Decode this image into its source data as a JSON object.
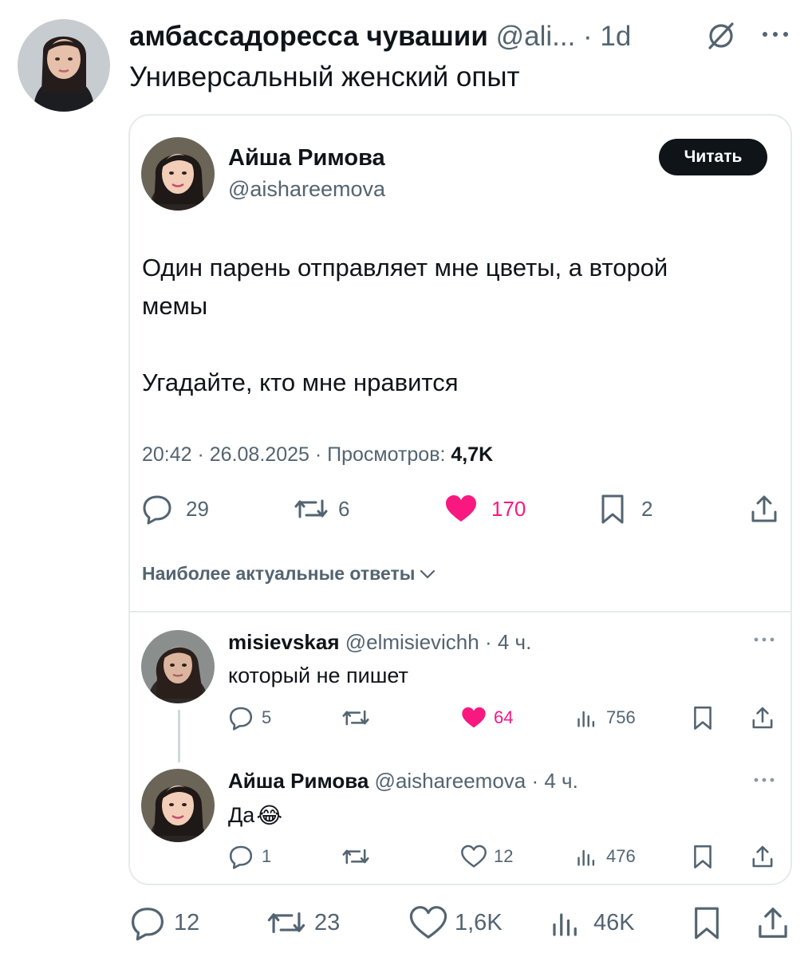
{
  "outer": {
    "display_name": "амбассадоресса чувашии",
    "handle": "@ali...",
    "separator": " · ",
    "time": "1d",
    "text": "Универсальный женский опыт"
  },
  "quote": {
    "display_name": "Айша Римова",
    "handle": "@aishareemova",
    "read_label": "Читать",
    "line1": "Один парень отправляет мне цветы, а второй",
    "line2": "мемы",
    "line3": "Угадайте, кто мне нравится",
    "meta_prefix": "20:42 · 26.08.2025 · Просмотров: ",
    "meta_views": "4,7K",
    "replies": "29",
    "reposts": "6",
    "likes": "170",
    "bookmarks": "2",
    "sort_label": "Наиболее актуальные ответы"
  },
  "reply1": {
    "display_name": "misievskaя",
    "handle": "@elmisievichh",
    "time": " · 4 ч.",
    "text": "который не пишет",
    "replies": "5",
    "likes": "64",
    "views": "756"
  },
  "reply2": {
    "display_name": "Айша Римова",
    "handle": "@aishareemova",
    "time": " · 4 ч.",
    "text": "Да",
    "emoji": "😂",
    "replies": "1",
    "likes": "12",
    "views": "476"
  },
  "bottom": {
    "replies": "12",
    "reposts": "23",
    "likes": "1,6K",
    "views": "46K"
  },
  "colors": {
    "text": "#0f1419",
    "muted": "#536471",
    "like": "#f91880",
    "border": "#e6eaed",
    "button_bg": "#0f1419"
  },
  "icons": [
    "reply-icon",
    "repost-icon",
    "like-icon",
    "bookmark-icon",
    "share-icon",
    "views-icon",
    "more-icon",
    "grok-icon",
    "chevron-down-icon"
  ]
}
